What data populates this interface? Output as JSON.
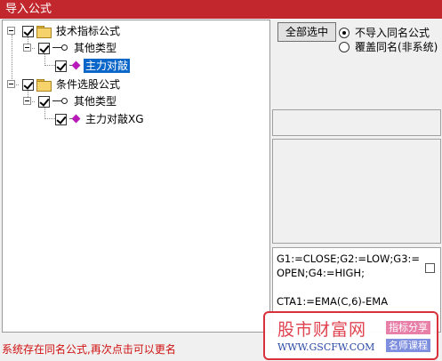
{
  "window": {
    "title": "导入公式"
  },
  "tree": {
    "root1": {
      "label": "技术指标公式"
    },
    "group1": {
      "label": "其他类型"
    },
    "item1": {
      "label": "主力对敲"
    },
    "root2": {
      "label": "条件选股公式"
    },
    "group2": {
      "label": "其他类型"
    },
    "item2": {
      "label": "主力对敲XG"
    }
  },
  "options": {
    "select_all_label": "全部选中",
    "no_import_label": "不导入同名公式",
    "overwrite_label": "覆盖同名(非系统)"
  },
  "code": {
    "lines": [
      "G1:=CLOSE;G2:=LOW;G3:=",
      "OPEN;G4:=HIGH;",
      "",
      "CTA1:=EMA(C,6)-EMA"
    ]
  },
  "status": {
    "message": "系统存在同名公式,再次点击可以更名"
  },
  "watermark": {
    "title": "股市财富网",
    "tag_share": "指标分享",
    "url": "WWW.GSCFW.COM",
    "tag_course": "名师课程"
  }
}
